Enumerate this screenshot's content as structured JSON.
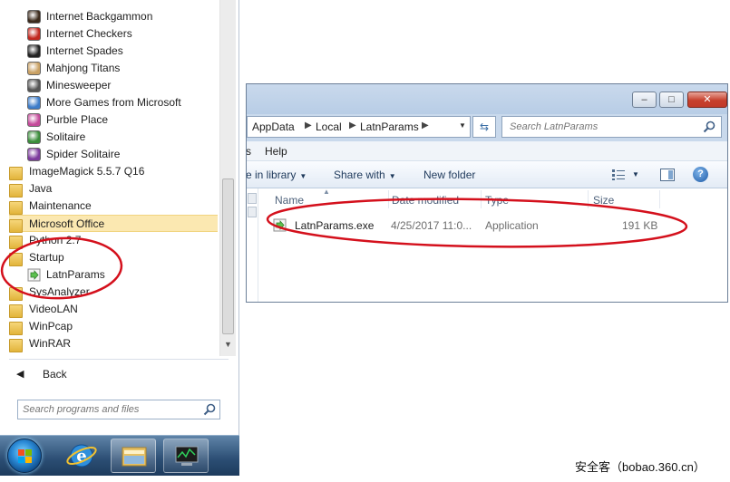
{
  "start_menu": {
    "programs": [
      {
        "label": "Internet Backgammon",
        "icon": "backgammon-icon",
        "indent": 1
      },
      {
        "label": "Internet Checkers",
        "icon": "checkers-icon",
        "indent": 1
      },
      {
        "label": "Internet Spades",
        "icon": "spades-icon",
        "indent": 1
      },
      {
        "label": "Mahjong Titans",
        "icon": "mahjong-icon",
        "indent": 1
      },
      {
        "label": "Minesweeper",
        "icon": "minesweeper-icon",
        "indent": 1
      },
      {
        "label": "More Games from Microsoft",
        "icon": "more-games-icon",
        "indent": 1
      },
      {
        "label": "Purble Place",
        "icon": "purble-place-icon",
        "indent": 1
      },
      {
        "label": "Solitaire",
        "icon": "solitaire-icon",
        "indent": 1
      },
      {
        "label": "Spider Solitaire",
        "icon": "spider-solitaire-icon",
        "indent": 1
      },
      {
        "label": "ImageMagick 5.5.7 Q16",
        "icon": "folder-icon",
        "indent": 0
      },
      {
        "label": "Java",
        "icon": "folder-icon",
        "indent": 0
      },
      {
        "label": "Maintenance",
        "icon": "folder-icon",
        "indent": 0
      },
      {
        "label": "Microsoft Office",
        "icon": "folder-icon",
        "indent": 0,
        "highlighted": true
      },
      {
        "label": "Python 2.7",
        "icon": "folder-icon",
        "indent": 0
      },
      {
        "label": "Startup",
        "icon": "folder-icon",
        "indent": 0
      },
      {
        "label": "LatnParams",
        "icon": "executable-icon",
        "indent": 1
      },
      {
        "label": "SysAnalyzer",
        "icon": "folder-icon",
        "indent": 0
      },
      {
        "label": "VideoLAN",
        "icon": "folder-icon",
        "indent": 0
      },
      {
        "label": "WinPcap",
        "icon": "folder-icon",
        "indent": 0
      },
      {
        "label": "WinRAR",
        "icon": "folder-icon",
        "indent": 0
      }
    ],
    "back_label": "Back",
    "search_placeholder": "Search programs and files"
  },
  "taskbar": {
    "items": [
      "start-orb",
      "internet-explorer-icon",
      "windows-explorer-icon",
      "task-manager-icon"
    ]
  },
  "explorer": {
    "breadcrumb": [
      "AppData",
      "Local",
      "LatnParams"
    ],
    "search_placeholder": "Search LatnParams",
    "menu": {
      "help": "Help"
    },
    "toolbar": {
      "include_in_library": "e in library",
      "share_with": "Share with",
      "new_folder": "New folder"
    },
    "columns": {
      "name": "Name",
      "date_modified": "Date modified",
      "type": "Type",
      "size": "Size"
    },
    "files": [
      {
        "name": "LatnParams.exe",
        "date_modified": "4/25/2017 11:0...",
        "type": "Application",
        "size": "191 KB"
      }
    ]
  },
  "annotation_color": "#d4101c",
  "watermark": "安全客（bobao.360.cn）"
}
